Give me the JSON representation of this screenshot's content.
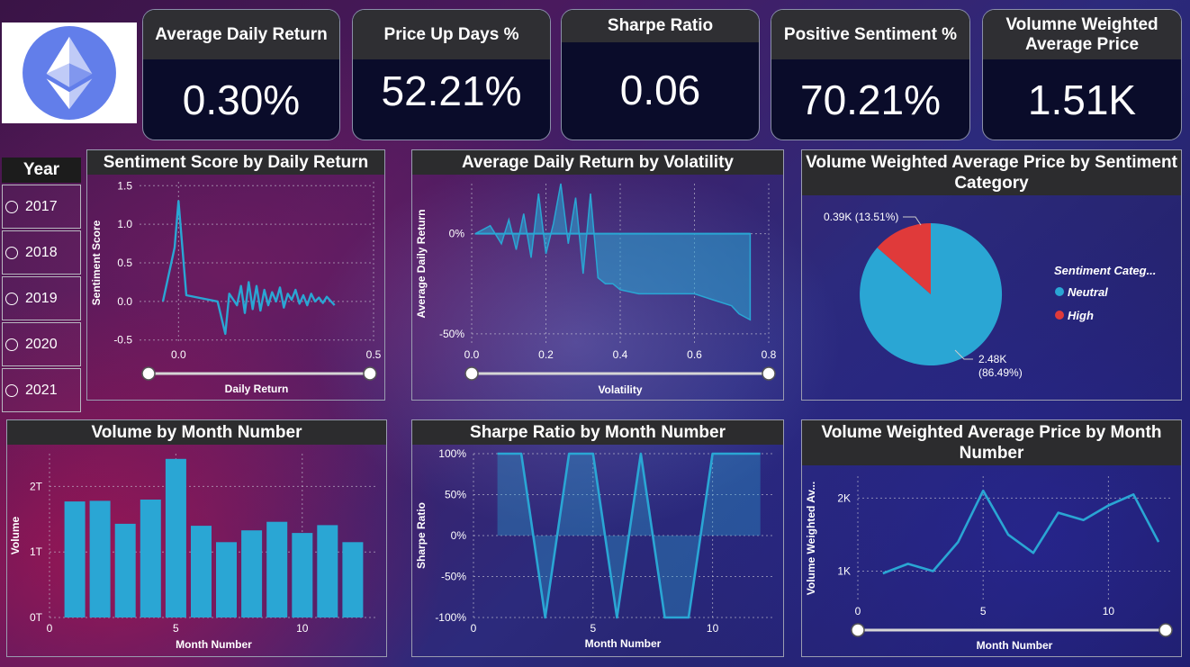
{
  "colors": {
    "accent": "#2aa6d4",
    "red": "#e03a3a",
    "panel_head": "#2c2c2e"
  },
  "kpis": [
    {
      "title": "Average Daily Return",
      "value": "0.30%"
    },
    {
      "title": "Price Up Days %",
      "value": "52.21%"
    },
    {
      "title": "Sharpe Ratio",
      "value": "0.06"
    },
    {
      "title": "Positive Sentiment %",
      "value": "70.21%"
    },
    {
      "title": "Volumne Weighted Average Price",
      "value": "1.51K"
    }
  ],
  "slicer": {
    "title": "Year",
    "items": [
      "2017",
      "2018",
      "2019",
      "2020",
      "2021"
    ]
  },
  "panels": {
    "sentiment": {
      "title": "Sentiment Score by Daily Return"
    },
    "volatility": {
      "title": "Average Daily Return by Volatility"
    },
    "vwap_pie": {
      "title": "Volume Weighted Average Price by Sentiment Category"
    },
    "volume": {
      "title": "Volume by Month Number"
    },
    "sharpe": {
      "title": "Sharpe Ratio by Month Number"
    },
    "vwap_line": {
      "title": "Volume Weighted Average Price by Month Number"
    }
  },
  "chart_data": [
    {
      "id": "sentiment",
      "type": "line",
      "title": "Sentiment Score by Daily Return",
      "xlabel": "Daily Return",
      "ylabel": "Sentiment Score",
      "xlim": [
        -0.1,
        0.5
      ],
      "ylim": [
        -0.55,
        1.55
      ],
      "xticks": [
        "0.0",
        "0.5"
      ],
      "xtick_values": [
        0.0,
        0.5
      ],
      "yticks": [
        "1.5",
        "1.0",
        "0.5",
        "0.0",
        "-0.5"
      ],
      "ytick_values": [
        1.5,
        1.0,
        0.5,
        0.0,
        -0.5
      ],
      "x": [
        -0.04,
        -0.01,
        0.0,
        0.02,
        0.1,
        0.12,
        0.13,
        0.15,
        0.16,
        0.17,
        0.18,
        0.19,
        0.2,
        0.21,
        0.22,
        0.23,
        0.24,
        0.25,
        0.26,
        0.27,
        0.28,
        0.29,
        0.3,
        0.31,
        0.32,
        0.33,
        0.34,
        0.35,
        0.36,
        0.37,
        0.38,
        0.4
      ],
      "y": [
        0.0,
        0.7,
        1.3,
        0.08,
        0.0,
        -0.42,
        0.1,
        -0.05,
        0.2,
        -0.15,
        0.25,
        -0.1,
        0.2,
        -0.12,
        0.15,
        -0.05,
        0.12,
        0.0,
        0.18,
        -0.08,
        0.1,
        0.02,
        0.15,
        -0.03,
        0.08,
        -0.05,
        0.1,
        0.0,
        0.05,
        -0.02,
        0.06,
        -0.05
      ]
    },
    {
      "id": "volatility",
      "type": "area",
      "title": "Average Daily Return by Volatility",
      "xlabel": "Volatility",
      "ylabel": "Average Daily Return",
      "xlim": [
        0.0,
        0.8
      ],
      "ylim": [
        -0.55,
        0.25
      ],
      "xticks": [
        "0.0",
        "0.2",
        "0.4",
        "0.6",
        "0.8"
      ],
      "xtick_values": [
        0.0,
        0.2,
        0.4,
        0.6,
        0.8
      ],
      "yticks": [
        "0%",
        "-50%"
      ],
      "ytick_values": [
        0.0,
        -0.5
      ],
      "x": [
        0.01,
        0.05,
        0.08,
        0.1,
        0.12,
        0.14,
        0.16,
        0.18,
        0.2,
        0.22,
        0.24,
        0.26,
        0.28,
        0.3,
        0.32,
        0.34,
        0.36,
        0.38,
        0.4,
        0.45,
        0.5,
        0.55,
        0.6,
        0.65,
        0.7,
        0.72,
        0.74,
        0.75
      ],
      "y": [
        0.0,
        0.04,
        -0.05,
        0.07,
        -0.08,
        0.1,
        -0.12,
        0.2,
        -0.1,
        0.05,
        0.25,
        -0.05,
        0.18,
        -0.2,
        0.2,
        -0.22,
        -0.25,
        -0.25,
        -0.28,
        -0.3,
        -0.3,
        -0.3,
        -0.3,
        -0.33,
        -0.36,
        -0.4,
        -0.42,
        -0.43
      ]
    },
    {
      "id": "vwap_pie",
      "type": "pie",
      "title": "Volume Weighted Average Price by Sentiment Category",
      "legend_title": "Sentiment Categ...",
      "legend_position": "right",
      "slices": [
        {
          "name": "Neutral",
          "value": 2.48,
          "label": "2.48K (86.49%)",
          "color": "#2aa6d4"
        },
        {
          "name": "High",
          "value": 0.39,
          "label": "0.39K (13.51%)",
          "color": "#e03a3a"
        }
      ]
    },
    {
      "id": "volume",
      "type": "bar",
      "title": "Volume by Month Number",
      "xlabel": "Month Number",
      "ylabel": "Volume",
      "xlim": [
        0,
        13
      ],
      "ylim": [
        0,
        2.5
      ],
      "xticks": [
        "0",
        "5",
        "10"
      ],
      "xtick_values": [
        0,
        5,
        10
      ],
      "yticks": [
        "2T",
        "1T",
        "0T"
      ],
      "ytick_values": [
        2,
        1,
        0
      ],
      "categories": [
        1,
        2,
        3,
        4,
        5,
        6,
        7,
        8,
        9,
        10,
        11,
        12
      ],
      "values": [
        1.77,
        1.78,
        1.43,
        1.8,
        2.42,
        1.4,
        1.15,
        1.33,
        1.46,
        1.29,
        1.41,
        1.15
      ]
    },
    {
      "id": "sharpe",
      "type": "area",
      "title": "Sharpe Ratio by Month Number",
      "xlabel": "Month Number",
      "ylabel": "Sharpe Ratio",
      "xlim": [
        0,
        12.5
      ],
      "ylim": [
        -1.0,
        1.0
      ],
      "xticks": [
        "0",
        "5",
        "10"
      ],
      "xtick_values": [
        0,
        5,
        10
      ],
      "yticks": [
        "100%",
        "50%",
        "0%",
        "-50%",
        "-100%"
      ],
      "ytick_values": [
        1.0,
        0.5,
        0.0,
        -0.5,
        -1.0
      ],
      "x": [
        1,
        2,
        3,
        4,
        5,
        6,
        7,
        8,
        9,
        10,
        11,
        12
      ],
      "y": [
        1.0,
        1.0,
        -1.0,
        1.0,
        1.0,
        -1.0,
        1.0,
        -1.0,
        -1.0,
        1.0,
        1.0,
        1.0
      ]
    },
    {
      "id": "vwap_line",
      "type": "line",
      "title": "Volume Weighted Average Price by Month Number",
      "xlabel": "Month Number",
      "ylabel": "Volume Weighted Av...",
      "xlim": [
        0,
        12.5
      ],
      "ylim": [
        0.6,
        2.3
      ],
      "xticks": [
        "0",
        "5",
        "10"
      ],
      "xtick_values": [
        0,
        5,
        10
      ],
      "yticks": [
        "2K",
        "1K"
      ],
      "ytick_values": [
        2,
        1
      ],
      "x": [
        1,
        2,
        3,
        4,
        5,
        6,
        7,
        8,
        9,
        10,
        11,
        12
      ],
      "y": [
        0.97,
        1.1,
        1.0,
        1.4,
        2.1,
        1.5,
        1.25,
        1.8,
        1.7,
        1.9,
        2.05,
        1.4
      ]
    }
  ]
}
